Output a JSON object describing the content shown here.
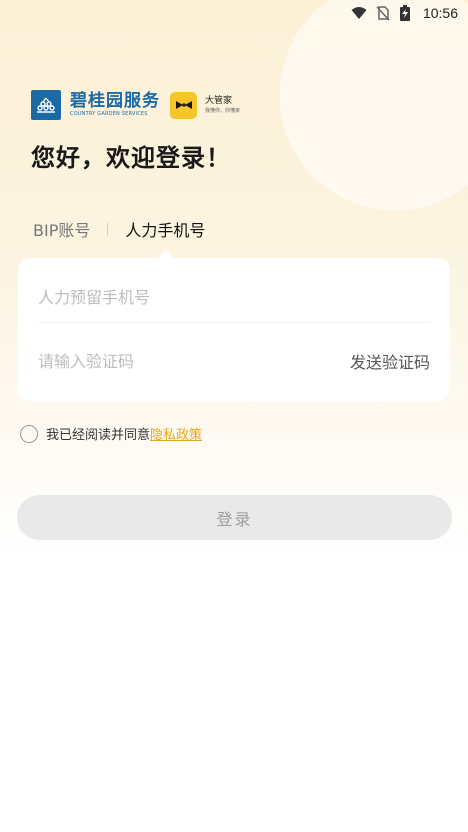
{
  "status_bar": {
    "time": "10:56",
    "icons": [
      "wifi-icon",
      "no-sim-icon",
      "battery-charging-icon"
    ]
  },
  "brand": {
    "name_cn": "碧桂园服务",
    "name_en": "COUNTRY GARDEN SERVICES",
    "butler_name": "大管家",
    "butler_slogan": "我懂你，你懂家",
    "logo_color": "#1b6aa6",
    "butler_color": "#f6c52a"
  },
  "greeting": "您好，欢迎登录！",
  "tabs": [
    {
      "label": "BIP账号",
      "active": false
    },
    {
      "label": "人力手机号",
      "active": true
    }
  ],
  "form": {
    "phone_placeholder": "人力预留手机号",
    "code_placeholder": "请输入验证码",
    "send_code_label": "发送验证码"
  },
  "agreement": {
    "text": "我已经阅读并同意",
    "link_label": "隐私政策",
    "link_color": "#e6a521"
  },
  "login_button": "登录"
}
